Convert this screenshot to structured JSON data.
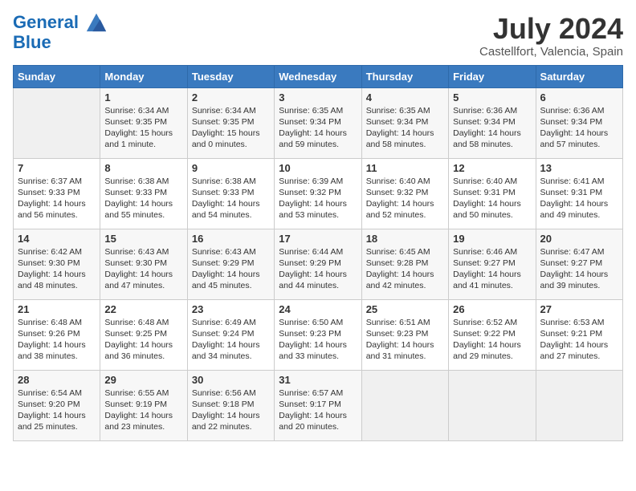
{
  "header": {
    "logo_line1": "General",
    "logo_line2": "Blue",
    "month_title": "July 2024",
    "location": "Castellfort, Valencia, Spain"
  },
  "days_of_week": [
    "Sunday",
    "Monday",
    "Tuesday",
    "Wednesday",
    "Thursday",
    "Friday",
    "Saturday"
  ],
  "weeks": [
    [
      {
        "day": "",
        "sunrise": "",
        "sunset": "",
        "daylight": ""
      },
      {
        "day": "1",
        "sunrise": "Sunrise: 6:34 AM",
        "sunset": "Sunset: 9:35 PM",
        "daylight": "Daylight: 15 hours and 1 minute."
      },
      {
        "day": "2",
        "sunrise": "Sunrise: 6:34 AM",
        "sunset": "Sunset: 9:35 PM",
        "daylight": "Daylight: 15 hours and 0 minutes."
      },
      {
        "day": "3",
        "sunrise": "Sunrise: 6:35 AM",
        "sunset": "Sunset: 9:34 PM",
        "daylight": "Daylight: 14 hours and 59 minutes."
      },
      {
        "day": "4",
        "sunrise": "Sunrise: 6:35 AM",
        "sunset": "Sunset: 9:34 PM",
        "daylight": "Daylight: 14 hours and 58 minutes."
      },
      {
        "day": "5",
        "sunrise": "Sunrise: 6:36 AM",
        "sunset": "Sunset: 9:34 PM",
        "daylight": "Daylight: 14 hours and 58 minutes."
      },
      {
        "day": "6",
        "sunrise": "Sunrise: 6:36 AM",
        "sunset": "Sunset: 9:34 PM",
        "daylight": "Daylight: 14 hours and 57 minutes."
      }
    ],
    [
      {
        "day": "7",
        "sunrise": "Sunrise: 6:37 AM",
        "sunset": "Sunset: 9:33 PM",
        "daylight": "Daylight: 14 hours and 56 minutes."
      },
      {
        "day": "8",
        "sunrise": "Sunrise: 6:38 AM",
        "sunset": "Sunset: 9:33 PM",
        "daylight": "Daylight: 14 hours and 55 minutes."
      },
      {
        "day": "9",
        "sunrise": "Sunrise: 6:38 AM",
        "sunset": "Sunset: 9:33 PM",
        "daylight": "Daylight: 14 hours and 54 minutes."
      },
      {
        "day": "10",
        "sunrise": "Sunrise: 6:39 AM",
        "sunset": "Sunset: 9:32 PM",
        "daylight": "Daylight: 14 hours and 53 minutes."
      },
      {
        "day": "11",
        "sunrise": "Sunrise: 6:40 AM",
        "sunset": "Sunset: 9:32 PM",
        "daylight": "Daylight: 14 hours and 52 minutes."
      },
      {
        "day": "12",
        "sunrise": "Sunrise: 6:40 AM",
        "sunset": "Sunset: 9:31 PM",
        "daylight": "Daylight: 14 hours and 50 minutes."
      },
      {
        "day": "13",
        "sunrise": "Sunrise: 6:41 AM",
        "sunset": "Sunset: 9:31 PM",
        "daylight": "Daylight: 14 hours and 49 minutes."
      }
    ],
    [
      {
        "day": "14",
        "sunrise": "Sunrise: 6:42 AM",
        "sunset": "Sunset: 9:30 PM",
        "daylight": "Daylight: 14 hours and 48 minutes."
      },
      {
        "day": "15",
        "sunrise": "Sunrise: 6:43 AM",
        "sunset": "Sunset: 9:30 PM",
        "daylight": "Daylight: 14 hours and 47 minutes."
      },
      {
        "day": "16",
        "sunrise": "Sunrise: 6:43 AM",
        "sunset": "Sunset: 9:29 PM",
        "daylight": "Daylight: 14 hours and 45 minutes."
      },
      {
        "day": "17",
        "sunrise": "Sunrise: 6:44 AM",
        "sunset": "Sunset: 9:29 PM",
        "daylight": "Daylight: 14 hours and 44 minutes."
      },
      {
        "day": "18",
        "sunrise": "Sunrise: 6:45 AM",
        "sunset": "Sunset: 9:28 PM",
        "daylight": "Daylight: 14 hours and 42 minutes."
      },
      {
        "day": "19",
        "sunrise": "Sunrise: 6:46 AM",
        "sunset": "Sunset: 9:27 PM",
        "daylight": "Daylight: 14 hours and 41 minutes."
      },
      {
        "day": "20",
        "sunrise": "Sunrise: 6:47 AM",
        "sunset": "Sunset: 9:27 PM",
        "daylight": "Daylight: 14 hours and 39 minutes."
      }
    ],
    [
      {
        "day": "21",
        "sunrise": "Sunrise: 6:48 AM",
        "sunset": "Sunset: 9:26 PM",
        "daylight": "Daylight: 14 hours and 38 minutes."
      },
      {
        "day": "22",
        "sunrise": "Sunrise: 6:48 AM",
        "sunset": "Sunset: 9:25 PM",
        "daylight": "Daylight: 14 hours and 36 minutes."
      },
      {
        "day": "23",
        "sunrise": "Sunrise: 6:49 AM",
        "sunset": "Sunset: 9:24 PM",
        "daylight": "Daylight: 14 hours and 34 minutes."
      },
      {
        "day": "24",
        "sunrise": "Sunrise: 6:50 AM",
        "sunset": "Sunset: 9:23 PM",
        "daylight": "Daylight: 14 hours and 33 minutes."
      },
      {
        "day": "25",
        "sunrise": "Sunrise: 6:51 AM",
        "sunset": "Sunset: 9:23 PM",
        "daylight": "Daylight: 14 hours and 31 minutes."
      },
      {
        "day": "26",
        "sunrise": "Sunrise: 6:52 AM",
        "sunset": "Sunset: 9:22 PM",
        "daylight": "Daylight: 14 hours and 29 minutes."
      },
      {
        "day": "27",
        "sunrise": "Sunrise: 6:53 AM",
        "sunset": "Sunset: 9:21 PM",
        "daylight": "Daylight: 14 hours and 27 minutes."
      }
    ],
    [
      {
        "day": "28",
        "sunrise": "Sunrise: 6:54 AM",
        "sunset": "Sunset: 9:20 PM",
        "daylight": "Daylight: 14 hours and 25 minutes."
      },
      {
        "day": "29",
        "sunrise": "Sunrise: 6:55 AM",
        "sunset": "Sunset: 9:19 PM",
        "daylight": "Daylight: 14 hours and 23 minutes."
      },
      {
        "day": "30",
        "sunrise": "Sunrise: 6:56 AM",
        "sunset": "Sunset: 9:18 PM",
        "daylight": "Daylight: 14 hours and 22 minutes."
      },
      {
        "day": "31",
        "sunrise": "Sunrise: 6:57 AM",
        "sunset": "Sunset: 9:17 PM",
        "daylight": "Daylight: 14 hours and 20 minutes."
      },
      {
        "day": "",
        "sunrise": "",
        "sunset": "",
        "daylight": ""
      },
      {
        "day": "",
        "sunrise": "",
        "sunset": "",
        "daylight": ""
      },
      {
        "day": "",
        "sunrise": "",
        "sunset": "",
        "daylight": ""
      }
    ]
  ]
}
